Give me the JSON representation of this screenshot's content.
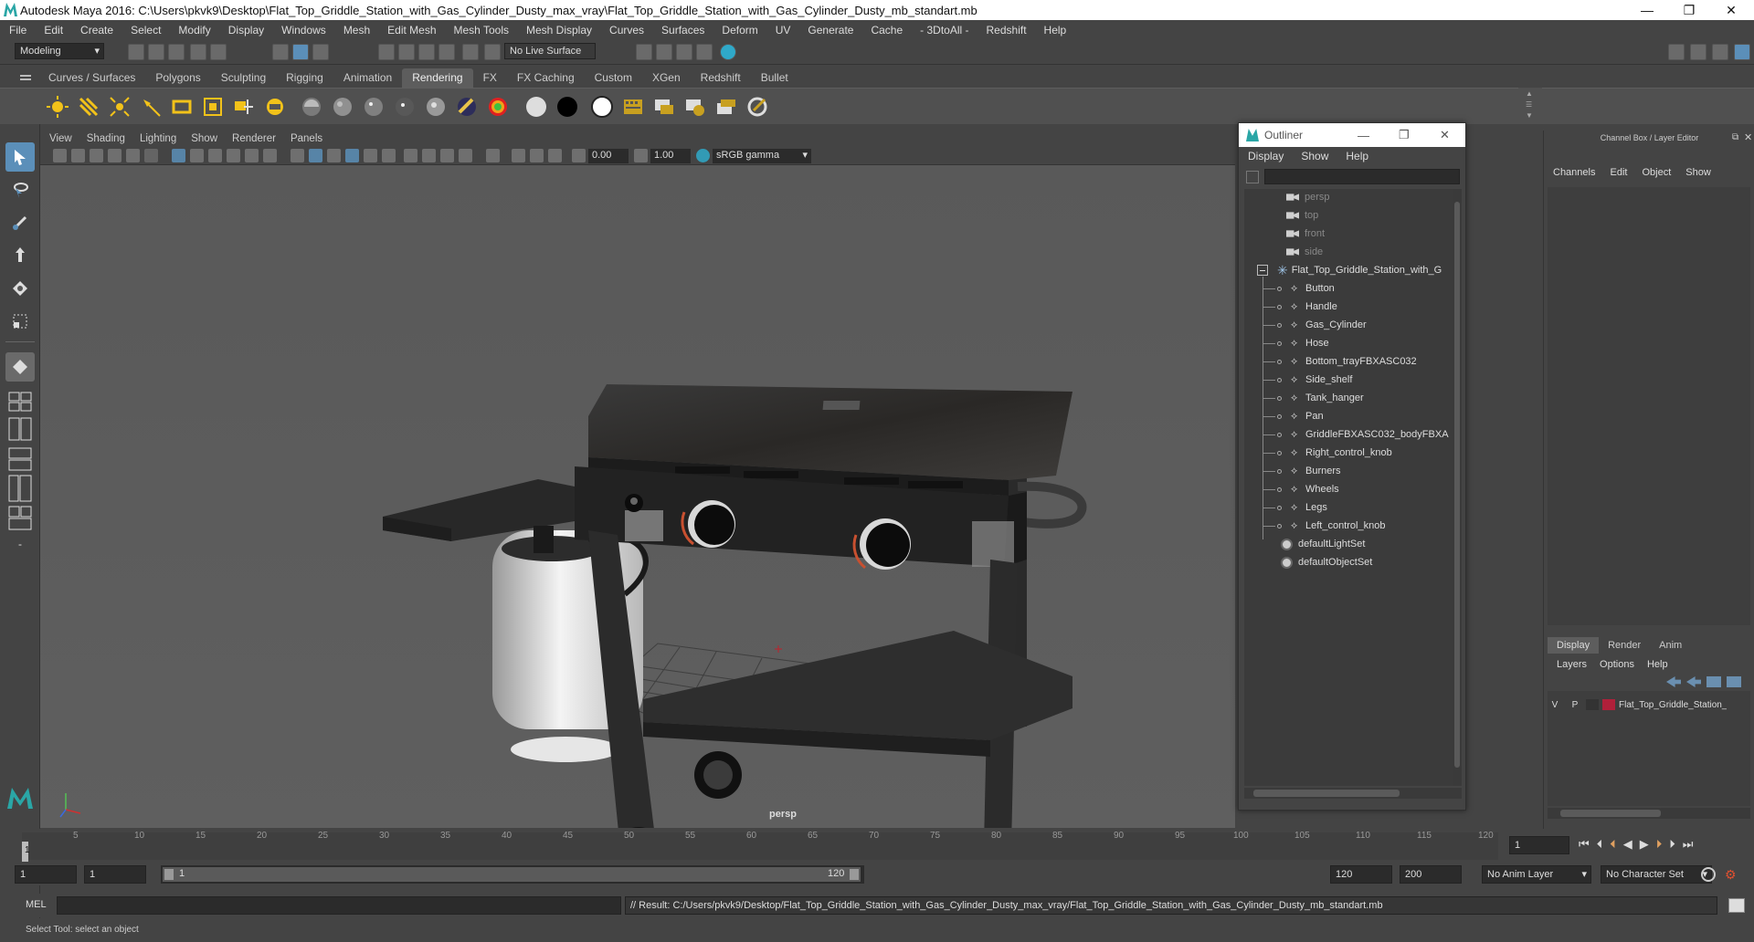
{
  "window": {
    "title": "Autodesk Maya 2016: C:\\Users\\pkvk9\\Desktop\\Flat_Top_Griddle_Station_with_Gas_Cylinder_Dusty_max_vray\\Flat_Top_Griddle_Station_with_Gas_Cylinder_Dusty_mb_standart.mb",
    "minimize": "—",
    "restore": "❐",
    "close": "✕"
  },
  "menubar": [
    "File",
    "Edit",
    "Create",
    "Select",
    "Modify",
    "Display",
    "Windows",
    "Mesh",
    "Edit Mesh",
    "Mesh Tools",
    "Mesh Display",
    "Curves",
    "Surfaces",
    "Deform",
    "UV",
    "Generate",
    "Cache",
    "- 3DtoAll -",
    "Redshift",
    "Help"
  ],
  "statusline": {
    "mode": "Modeling",
    "live_surface": "No Live Surface"
  },
  "shelf_tabs": [
    "Curves / Surfaces",
    "Polygons",
    "Sculpting",
    "Rigging",
    "Animation",
    "Rendering",
    "FX",
    "FX Caching",
    "Custom",
    "XGen",
    "Redshift",
    "Bullet"
  ],
  "shelf_active": "Rendering",
  "viewport": {
    "menu": [
      "View",
      "Shading",
      "Lighting",
      "Show",
      "Renderer",
      "Panels"
    ],
    "exposure": "0.00",
    "gamma": "1.00",
    "color_space": "sRGB gamma",
    "camera_label": "persp"
  },
  "outliner": {
    "title": "Outliner",
    "menu": [
      "Display",
      "Show",
      "Help"
    ],
    "cameras": [
      "persp",
      "top",
      "front",
      "side"
    ],
    "root": "Flat_Top_Griddle_Station_with_G",
    "children": [
      "Button",
      "Handle",
      "Gas_Cylinder",
      "Hose",
      "Bottom_trayFBXASC032",
      "Side_shelf",
      "Tank_hanger",
      "Pan",
      "GriddleFBXASC032_bodyFBXA",
      "Right_control_knob",
      "Burners",
      "Wheels",
      "Legs",
      "Left_control_knob"
    ],
    "sets": [
      "defaultLightSet",
      "defaultObjectSet"
    ]
  },
  "channel_box": {
    "title": "Channel Box / Layer Editor",
    "menu": [
      "Channels",
      "Edit",
      "Object",
      "Show"
    ],
    "tabs": [
      "Display",
      "Render",
      "Anim"
    ],
    "layer_menu": [
      "Layers",
      "Options",
      "Help"
    ],
    "layer": {
      "v": "V",
      "p": "P",
      "name": "Flat_Top_Griddle_Station_",
      "color": "#b0203a"
    }
  },
  "timeline": {
    "ticks": [
      "5",
      "10",
      "15",
      "20",
      "25",
      "30",
      "35",
      "40",
      "45",
      "50",
      "55",
      "60",
      "65",
      "70",
      "75",
      "80",
      "85",
      "90",
      "95",
      "100",
      "105",
      "110",
      "115",
      "120"
    ],
    "current_frame": "1",
    "start_field": "1"
  },
  "range": {
    "start": "1",
    "playback_start": "1",
    "range_start": "1",
    "range_end": "120",
    "end": "120",
    "max": "200",
    "anim_layer": "No Anim Layer",
    "character_set": "No Character Set"
  },
  "cmdline": {
    "label": "MEL",
    "result": "// Result: C:/Users/pkvk9/Desktop/Flat_Top_Griddle_Station_with_Gas_Cylinder_Dusty_max_vray/Flat_Top_Griddle_Station_with_Gas_Cylinder_Dusty_mb_standart.mb"
  },
  "helpline": "Select Tool: select an object"
}
